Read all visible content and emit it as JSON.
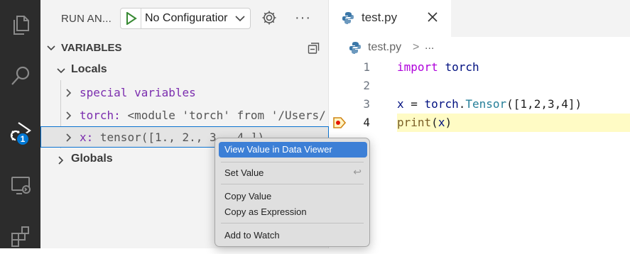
{
  "colors": {
    "activity_bar": "#2c2c2c",
    "accent": "#0078d4",
    "menu_highlight": "#3c7fd6",
    "current_line": "#fffbc5",
    "breakpoint": "#e51400"
  },
  "activity": {
    "badge": "1",
    "icons": [
      "files-icon",
      "search-icon",
      "debug-icon",
      "remote-explorer-icon",
      "extensions-icon"
    ]
  },
  "debug": {
    "title": "RUN AN...",
    "config": "No Configuratior",
    "variables_title": "VARIABLES",
    "locals": "Locals",
    "globals": "Globals",
    "rows": [
      {
        "name": "special variables",
        "value": ""
      },
      {
        "name": "torch:",
        "value": "<module 'torch' from '/Users/..."
      },
      {
        "name": "x:",
        "value": "tensor([1., 2., 3., 4.])"
      }
    ]
  },
  "editor": {
    "tab": "test.py",
    "breadcrumb_file": "test.py",
    "breadcrumb_sep": ">",
    "breadcrumb_more": "...",
    "lines": [
      {
        "num": "1",
        "tokens": [
          {
            "t": "import",
            "c": "kw"
          },
          {
            "t": " ",
            "c": ""
          },
          {
            "t": "torch",
            "c": "id"
          }
        ]
      },
      {
        "num": "2",
        "tokens": []
      },
      {
        "num": "3",
        "tokens": [
          {
            "t": "x",
            "c": "id"
          },
          {
            "t": " = ",
            "c": ""
          },
          {
            "t": "torch",
            "c": "id"
          },
          {
            "t": ".",
            "c": ""
          },
          {
            "t": "Tensor",
            "c": "ty"
          },
          {
            "t": "([1,2,3,4])",
            "c": ""
          }
        ]
      },
      {
        "num": "4",
        "tokens": [
          {
            "t": "print",
            "c": "fn"
          },
          {
            "t": "(",
            "c": ""
          },
          {
            "t": "x",
            "c": "id"
          },
          {
            "t": ")",
            "c": ""
          }
        ]
      }
    ]
  },
  "context_menu": {
    "items": [
      "View Value in Data Viewer",
      "Set Value",
      "Copy Value",
      "Copy as Expression",
      "Add to Watch"
    ],
    "set_value_shortcut": "↩"
  }
}
